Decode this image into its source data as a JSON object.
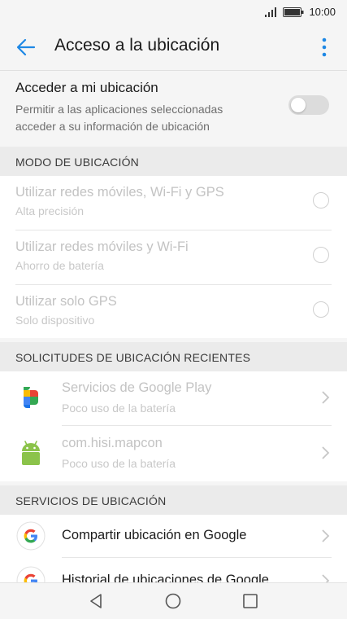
{
  "status_bar": {
    "time": "10:00"
  },
  "header": {
    "title": "Acceso a la ubicación"
  },
  "master": {
    "title": "Acceder a mi ubicación",
    "subtitle": "Permitir a las aplicaciones seleccionadas acceder a su información de ubicación",
    "enabled": false
  },
  "sections": {
    "mode": "MODO DE UBICACIÓN",
    "recent": "SOLICITUDES DE UBICACIÓN RECIENTES",
    "services": "SERVICIOS DE UBICACIÓN"
  },
  "modes": [
    {
      "title": "Utilizar redes móviles, Wi-Fi y GPS",
      "subtitle": "Alta precisión"
    },
    {
      "title": "Utilizar redes móviles y Wi-Fi",
      "subtitle": "Ahorro de batería"
    },
    {
      "title": "Utilizar solo GPS",
      "subtitle": "Solo dispositivo"
    }
  ],
  "recent": [
    {
      "title": "Servicios de Google Play",
      "subtitle": "Poco uso de la batería",
      "icon": "google-play-services-icon"
    },
    {
      "title": "com.hisi.mapcon",
      "subtitle": "Poco uso de la batería",
      "icon": "android-icon"
    }
  ],
  "services": [
    {
      "title": "Compartir ubicación en Google",
      "icon": "google-icon"
    },
    {
      "title": "Historial de ubicaciones de Google",
      "icon": "google-icon"
    }
  ],
  "colors": {
    "accent": "#1e88e5",
    "disabled_text": "#c3c3c3",
    "section_bg": "#ebebeb"
  }
}
